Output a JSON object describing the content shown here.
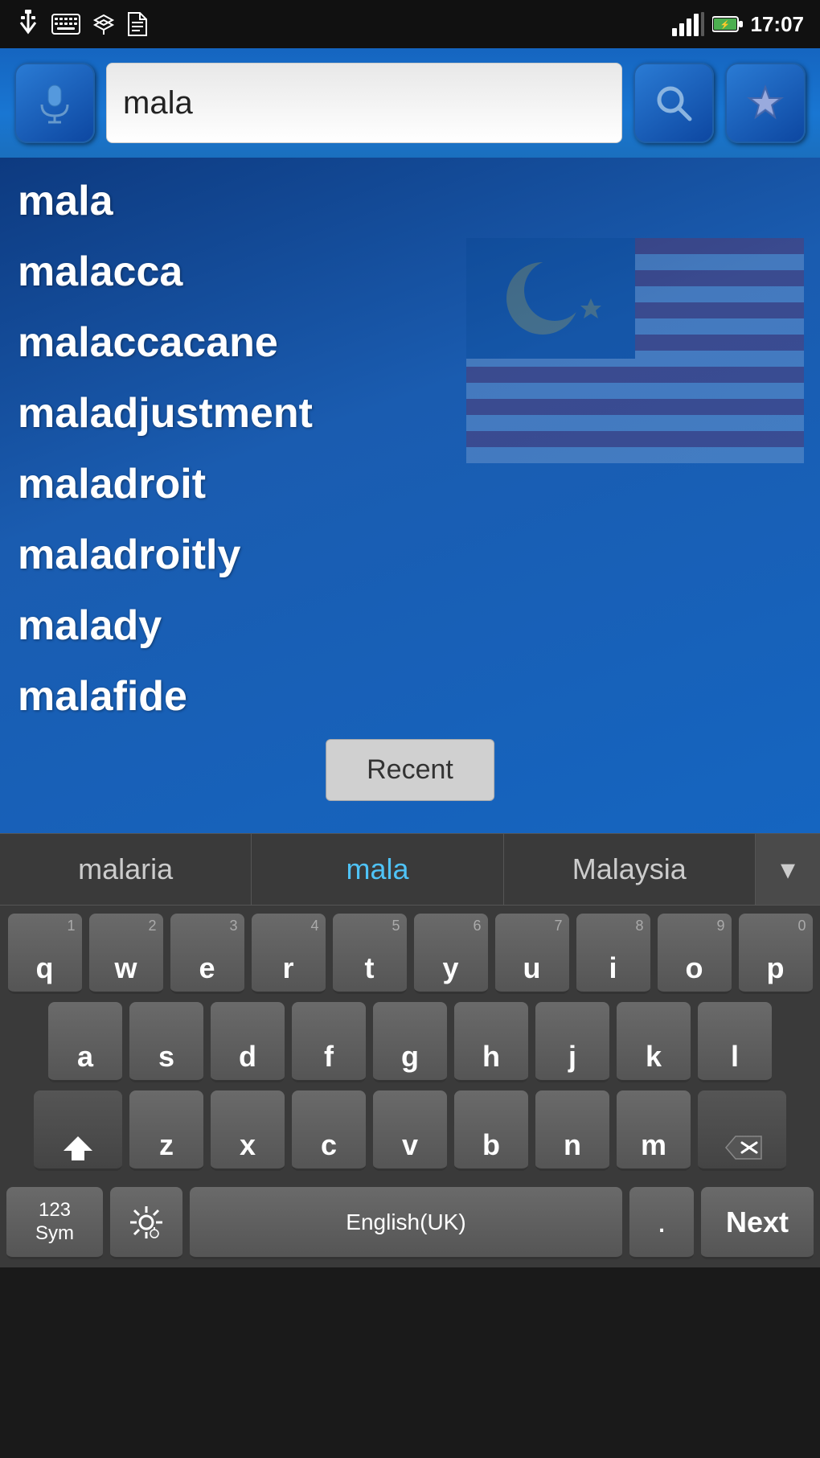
{
  "statusBar": {
    "time": "17:07",
    "icons": [
      "usb",
      "keyboard",
      "dropbox",
      "file"
    ]
  },
  "header": {
    "searchValue": "mala",
    "searchPlaceholder": "",
    "micLabel": "mic",
    "searchLabel": "search",
    "favLabel": "favorites"
  },
  "wordList": {
    "words": [
      "mala",
      "malacca",
      "malaccacane",
      "maladjustment",
      "maladroit",
      "maladroitly",
      "malady",
      "malafide"
    ],
    "recentLabel": "Recent"
  },
  "autocomplete": {
    "words": [
      "malaria",
      "mala",
      "Malaysia"
    ],
    "activeIndex": 1,
    "expandLabel": "▾"
  },
  "keyboard": {
    "row1": [
      {
        "key": "q",
        "num": "1"
      },
      {
        "key": "w",
        "num": "2"
      },
      {
        "key": "e",
        "num": "3"
      },
      {
        "key": "r",
        "num": "4"
      },
      {
        "key": "t",
        "num": "5"
      },
      {
        "key": "y",
        "num": "6"
      },
      {
        "key": "u",
        "num": "7"
      },
      {
        "key": "i",
        "num": "8"
      },
      {
        "key": "o",
        "num": "9"
      },
      {
        "key": "p",
        "num": "0"
      }
    ],
    "row2": [
      {
        "key": "a"
      },
      {
        "key": "s"
      },
      {
        "key": "d"
      },
      {
        "key": "f"
      },
      {
        "key": "g"
      },
      {
        "key": "h"
      },
      {
        "key": "j"
      },
      {
        "key": "k"
      },
      {
        "key": "l"
      }
    ],
    "row3Letters": [
      {
        "key": "z"
      },
      {
        "key": "x"
      },
      {
        "key": "c"
      },
      {
        "key": "v"
      },
      {
        "key": "b"
      },
      {
        "key": "n"
      },
      {
        "key": "m"
      }
    ],
    "shiftLabel": "⬆",
    "backspaceLabel": "⌫",
    "symLabel": "123\nSym",
    "settingsLabel": "⚙",
    "spaceLabel": "English(UK)",
    "periodLabel": ".",
    "nextLabel": "Next"
  }
}
